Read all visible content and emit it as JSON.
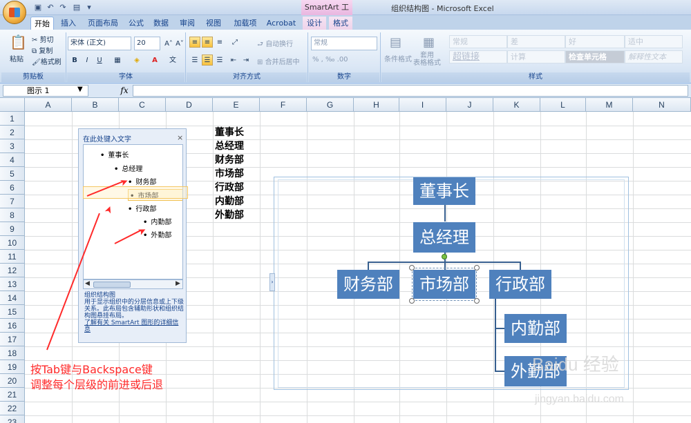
{
  "titlebar": {
    "contextual_title": "SmartArt 工具",
    "window_title": "组织结构图 - Microsoft Excel"
  },
  "tabs": [
    {
      "label": "开始",
      "active": true
    },
    {
      "label": "插入"
    },
    {
      "label": "页面布局"
    },
    {
      "label": "公式"
    },
    {
      "label": "数据"
    },
    {
      "label": "审阅"
    },
    {
      "label": "视图"
    },
    {
      "label": "加载项"
    },
    {
      "label": "Acrobat"
    },
    {
      "label": "设计",
      "contextual": true
    },
    {
      "label": "格式",
      "contextual": true
    }
  ],
  "ribbon": {
    "clipboard": {
      "paste": "粘贴",
      "cut": "剪切",
      "copy": "复制",
      "format_painter": "格式刷",
      "label": "剪贴板"
    },
    "font": {
      "name": "宋体 (正文)",
      "size": "20",
      "label": "字体"
    },
    "alignment": {
      "wrap": "自动换行",
      "merge": "合并后居中",
      "label": "对齐方式"
    },
    "number": {
      "format": "常规",
      "label": "数字"
    },
    "styles": {
      "conditional": "条件格式",
      "table_format": "套用\n表格格式",
      "cells": [
        "常规",
        "差",
        "好",
        "适中",
        "超链接",
        "计算",
        "检查单元格",
        "解释性文本"
      ],
      "label": "样式"
    }
  },
  "formula_bar": {
    "name_box": "图示 1",
    "fx": "fx",
    "content": ""
  },
  "columns": [
    "A",
    "B",
    "C",
    "D",
    "E",
    "F",
    "G",
    "H",
    "I",
    "J",
    "K",
    "L",
    "M",
    "N"
  ],
  "rows": [
    "1",
    "2",
    "3",
    "4",
    "5",
    "6",
    "7",
    "8",
    "9",
    "10",
    "11",
    "12",
    "13",
    "14",
    "15",
    "16",
    "17",
    "18",
    "19",
    "20",
    "21",
    "22",
    "23"
  ],
  "cells_E": [
    "董事长",
    "总经理",
    "财务部",
    "市场部",
    "行政部",
    "内勤部",
    "外勤部"
  ],
  "text_pane": {
    "title": "在此处键入文字",
    "close": "×",
    "items": [
      "董事长",
      "总经理",
      "财务部",
      "市场部",
      "行政部",
      "内勤部",
      "外勤部"
    ],
    "description": "组织结构图\n用于显示组织中的分层信息或上下级关系。此布局包含辅助形状和组织结构图悬挂布局。",
    "link": "了解有关 SmartArt 图形的详细信息"
  },
  "smartart": {
    "nodes": [
      "董事长",
      "总经理",
      "财务部",
      "市场部",
      "行政部",
      "内勤部",
      "外勤部"
    ],
    "fill": "#4f81bd",
    "line": "#375f8f"
  },
  "annotation": {
    "line1": "按Tab键与Backspace键",
    "line2": "调整每个层级的前进或后退",
    "color": "#ff2a2a"
  },
  "watermark": {
    "text": "Baidu 经验",
    "url": "jingyan.baidu.com"
  }
}
